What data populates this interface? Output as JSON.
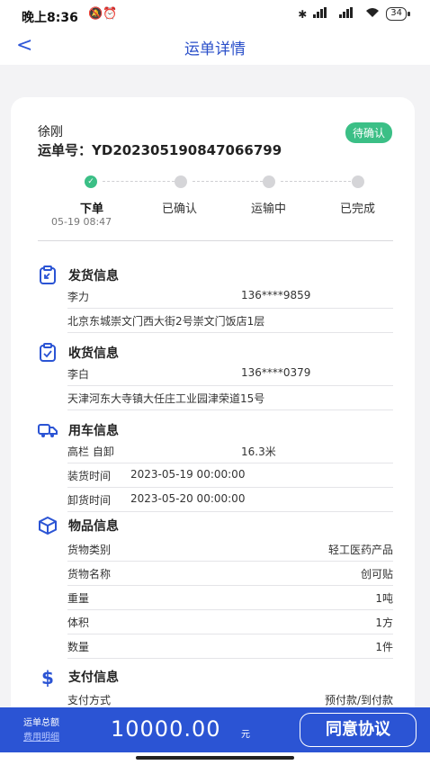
{
  "status": {
    "time": "晚上8:36",
    "left_icons": "🔕⏰",
    "battery": "34"
  },
  "nav": {
    "back": "<",
    "title": "运单详情"
  },
  "order": {
    "consignee": "徐刚",
    "waybill": "运单号：YD202305190847066799",
    "status_badge": "待确认",
    "steps": [
      "下单",
      "已确认",
      "运输中",
      "已完成"
    ],
    "step_time": "05-19 08:47",
    "current_step": 1
  },
  "sections": {
    "shipping": {
      "title": "发货信息",
      "name": "李力",
      "phone": "136****9859",
      "address": "北京东城崇文门西大街2号崇文门饭店1层"
    },
    "receiving": {
      "title": "收货信息",
      "name": "李白",
      "phone": "136****0379",
      "address": "天津河东大寺镇大任庄工业园津荣道15号"
    },
    "vehicle": {
      "title": "用车信息",
      "type": "高栏 自卸",
      "length": "16.3米",
      "load_label": "装货时间",
      "load_time": "2023-05-19 00:00:00",
      "unload_label": "卸货时间",
      "unload_time": "2023-05-20 00:00:00"
    },
    "goods": {
      "title": "物品信息",
      "rows": [
        {
          "label": "货物类别",
          "value": "轻工医药产品"
        },
        {
          "label": "货物名称",
          "value": "创可贴"
        },
        {
          "label": "重量",
          "value": "1吨"
        },
        {
          "label": "体积",
          "value": "1方"
        },
        {
          "label": "数量",
          "value": "1件"
        }
      ]
    },
    "payment": {
      "title": "支付信息",
      "method_label": "支付方式",
      "method": "预付款/到付款"
    }
  },
  "footer": {
    "total_label": "运单总额",
    "fee_link": "费用明细",
    "amount": "10000.00",
    "unit": "元",
    "agree_button": "同意协议"
  },
  "colors": {
    "primary": "#2b54d4",
    "success": "#3bbf86"
  }
}
